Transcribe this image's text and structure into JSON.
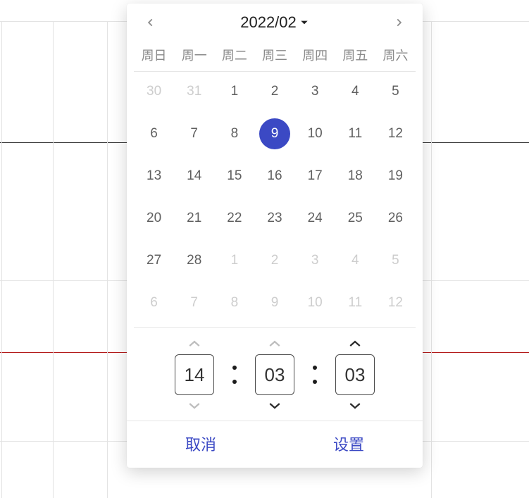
{
  "header": {
    "month_label": "2022/02"
  },
  "weekdays": [
    "周日",
    "周一",
    "周二",
    "周三",
    "周四",
    "周五",
    "周六"
  ],
  "days": [
    {
      "n": "30",
      "muted": true
    },
    {
      "n": "31",
      "muted": true
    },
    {
      "n": "1"
    },
    {
      "n": "2"
    },
    {
      "n": "3"
    },
    {
      "n": "4"
    },
    {
      "n": "5"
    },
    {
      "n": "6"
    },
    {
      "n": "7"
    },
    {
      "n": "8"
    },
    {
      "n": "9",
      "selected": true
    },
    {
      "n": "10"
    },
    {
      "n": "11"
    },
    {
      "n": "12"
    },
    {
      "n": "13"
    },
    {
      "n": "14"
    },
    {
      "n": "15"
    },
    {
      "n": "16"
    },
    {
      "n": "17"
    },
    {
      "n": "18"
    },
    {
      "n": "19"
    },
    {
      "n": "20"
    },
    {
      "n": "21"
    },
    {
      "n": "22"
    },
    {
      "n": "23"
    },
    {
      "n": "24"
    },
    {
      "n": "25"
    },
    {
      "n": "26"
    },
    {
      "n": "27"
    },
    {
      "n": "28"
    },
    {
      "n": "1",
      "muted": true
    },
    {
      "n": "2",
      "muted": true
    },
    {
      "n": "3",
      "muted": true
    },
    {
      "n": "4",
      "muted": true
    },
    {
      "n": "5",
      "muted": true
    },
    {
      "n": "6",
      "muted": true
    },
    {
      "n": "7",
      "muted": true
    },
    {
      "n": "8",
      "muted": true
    },
    {
      "n": "9",
      "muted": true
    },
    {
      "n": "10",
      "muted": true
    },
    {
      "n": "11",
      "muted": true
    },
    {
      "n": "12",
      "muted": true
    }
  ],
  "time": {
    "hour": "14",
    "minute": "03",
    "second": "03",
    "hour_up_enabled": false,
    "hour_down_enabled": false,
    "minute_up_enabled": false,
    "minute_down_enabled": true,
    "second_up_enabled": true,
    "second_down_enabled": true
  },
  "buttons": {
    "cancel": "取消",
    "confirm": "设置"
  },
  "colors": {
    "accent": "#3b49c4"
  }
}
